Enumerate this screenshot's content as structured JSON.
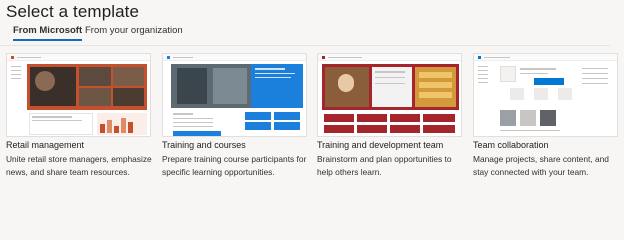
{
  "dialog": {
    "title": "Select a template"
  },
  "tabs": [
    {
      "label": "From Microsoft",
      "active": true
    },
    {
      "label": "From your organization",
      "active": false
    }
  ],
  "templates": [
    {
      "name": "Retail management",
      "description": "Unite retail store managers, emphasize news, and share team resources.",
      "accent": "#c4502e"
    },
    {
      "name": "Training and courses",
      "description": "Prepare training course participants for specific learning opportunities.",
      "accent": "#1b7fdc"
    },
    {
      "name": "Training and development team",
      "description": "Brainstorm and plan opportunities to help others learn.",
      "accent": "#a4262c"
    },
    {
      "name": "Team collaboration",
      "description": "Manage projects, share content, and stay connected with your team.",
      "accent": "#0078d4"
    }
  ]
}
